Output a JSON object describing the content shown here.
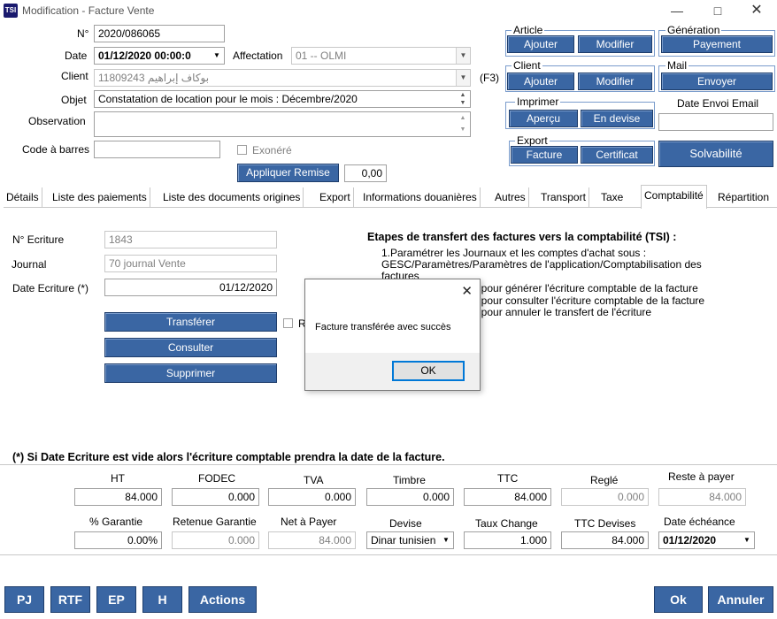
{
  "window": {
    "app_icon": "TSI",
    "title": "Modification - Facture Vente",
    "minimize_icon": "minimize-icon",
    "maximize_icon": "maximize-icon",
    "close_icon": "close-icon"
  },
  "header": {
    "numero_label": "N°",
    "numero_value": "2020/086065",
    "date_label": "Date",
    "date_value": "01/12/2020 00:00:0",
    "affectation_label": "Affectation",
    "affectation_value": "01 -- OLMI",
    "client_label": "Client",
    "client_value": "11809243 بوكاف إبراهيم",
    "f3_label": "(F3)",
    "objet_label": "Objet",
    "objet_value": "Constatation de location pour le mois  : Décembre/2020",
    "observation_label": "Observation",
    "observation_value": "",
    "code_barres_label": "Code à barres",
    "code_barres_value": "",
    "exonere_label": "Exonéré",
    "appliquer_remise_label": "Appliquer Remise",
    "remise_value": "0,00"
  },
  "groups": {
    "article": {
      "title": "Article",
      "ajouter": "Ajouter",
      "modifier": "Modifier"
    },
    "generation": {
      "title": "Génération",
      "payement": "Payement"
    },
    "client": {
      "title": "Client",
      "ajouter": "Ajouter",
      "modifier": "Modifier"
    },
    "mail": {
      "title": "Mail",
      "envoyer": "Envoyer"
    },
    "imprimer": {
      "title": "Imprimer",
      "apercu": "Aperçu",
      "en_devise": "En devise"
    },
    "date_envoi_email_label": "Date Envoi Email",
    "date_envoi_email_value": "",
    "export": {
      "title": "Export",
      "facture": "Facture",
      "certificat": "Certificat"
    },
    "solvabilite": "Solvabilité"
  },
  "tabs": [
    {
      "label": "Détails"
    },
    {
      "label": "Liste des paiements"
    },
    {
      "label": "Liste des documents origines"
    },
    {
      "label": "Export"
    },
    {
      "label": "Informations douanières"
    },
    {
      "label": "Autres"
    },
    {
      "label": "Transport"
    },
    {
      "label": "Taxe"
    },
    {
      "label": "Comptabilité"
    },
    {
      "label": "Répartition"
    }
  ],
  "comptabilite": {
    "ecriture_label": "N° Ecriture",
    "ecriture_value": "1843",
    "journal_label": "Journal",
    "journal_value": "70  journal Vente",
    "date_ecriture_label": "Date Ecriture (*)",
    "date_ecriture_value": "01/12/2020",
    "transferer": "Transférer",
    "consulter": "Consulter",
    "supprimer": "Supprimer",
    "checkbox_label": "R",
    "etapes_title": "Etapes de transfert des factures vers la comptabilité (TSI) :",
    "etape1_line1": "1.Paramétrer les Journaux et les comptes d'achat sous :",
    "etape1_line2": "GESC/Paramètres/Paramètres de l'application/Comptabilisation des",
    "etape1_line3": "factures",
    "step_line1": "er» pour générer l'écriture comptable de la facture",
    "step_line2": "er» pour consulter l'écriture comptable de la facture",
    "step_line3": "er» pour annuler le transfert  de l'écriture",
    "footnote": "(*) Si Date Ecriture est vide alors l'écriture comptable prendra la date de la facture."
  },
  "dialog": {
    "message": "Facture transférée avec succès",
    "ok": "OK",
    "close_icon": "close-icon"
  },
  "totals": {
    "ht_label": "HT",
    "ht_value": "84.000",
    "fodec_label": "FODEC",
    "fodec_value": "0.000",
    "tva_label": "TVA",
    "tva_value": "0.000",
    "timbre_label": "Timbre",
    "timbre_value": "0.000",
    "ttc_label": "TTC",
    "ttc_value": "84.000",
    "regle_label": "Reglé",
    "regle_value": "0.000",
    "reste_label": "Reste à payer",
    "reste_value": "84.000",
    "garantie_label": "% Garantie",
    "garantie_value": "0.00%",
    "retenue_label": "Retenue Garantie",
    "retenue_value": "0.000",
    "net_label": "Net à Payer",
    "net_value": "84.000",
    "devise_label": "Devise",
    "devise_value": "Dinar tunisien",
    "taux_label": "Taux Change",
    "taux_value": "1.000",
    "ttc_devises_label": "TTC Devises",
    "ttc_devises_value": "84.000",
    "echeance_label": "Date échéance",
    "echeance_value": "01/12/2020"
  },
  "footer": {
    "pj": "PJ",
    "rtf": "RTF",
    "ep": "EP",
    "h": "H",
    "actions": "Actions",
    "ok": "Ok",
    "annuler": "Annuler"
  },
  "colors": {
    "button_blue": "#3a66a3",
    "group_border": "#7a9ccc",
    "dialog_focus": "#0078d7"
  }
}
